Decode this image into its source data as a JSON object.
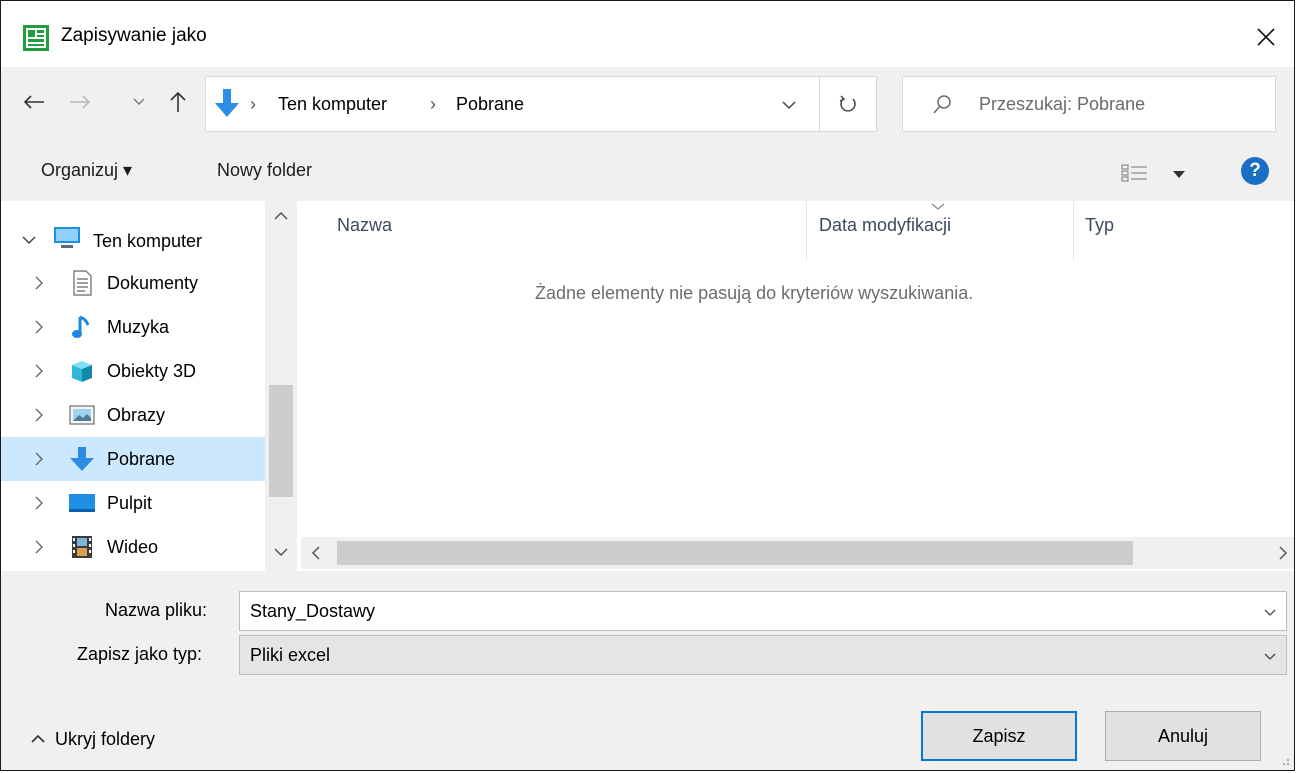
{
  "window": {
    "title": "Zapisywanie jako",
    "close_icon": "close-icon"
  },
  "nav": {
    "back_icon": "arrow-left-icon",
    "forward_icon": "arrow-right-icon",
    "recent_icon": "chevron-down-icon",
    "up_icon": "arrow-up-icon",
    "breadcrumb": [
      "Ten komputer",
      "Pobrane"
    ],
    "separator": "›",
    "search_placeholder": "Przeszukaj: Pobrane"
  },
  "toolbar": {
    "organize": "Organizuj ▾",
    "new_folder": "Nowy folder",
    "help": "?"
  },
  "tree": {
    "items": [
      {
        "label": "Ten komputer",
        "icon": "computer-icon",
        "expanded": true
      },
      {
        "label": "Dokumenty",
        "icon": "document-icon"
      },
      {
        "label": "Muzyka",
        "icon": "music-note-icon"
      },
      {
        "label": "Obiekty 3D",
        "icon": "cube-3d-icon"
      },
      {
        "label": "Obrazy",
        "icon": "pictures-icon"
      },
      {
        "label": "Pobrane",
        "icon": "download-arrow-icon",
        "selected": true
      },
      {
        "label": "Pulpit",
        "icon": "desktop-icon"
      },
      {
        "label": "Wideo",
        "icon": "video-icon"
      }
    ]
  },
  "files": {
    "columns": [
      "Nazwa",
      "Data modyfikacji",
      "Typ"
    ],
    "empty_message": "Żadne elementy nie pasują do kryteriów wyszukiwania."
  },
  "form": {
    "filename_label": "Nazwa pliku:",
    "filename_value": "Stany_Dostawy",
    "filetype_label": "Zapisz jako typ:",
    "filetype_value": "Pliki excel"
  },
  "footer": {
    "hide_folders": "Ukryj foldery",
    "save": "Zapisz",
    "cancel": "Anuluj"
  },
  "colors": {
    "accent": "#0078d7",
    "selected_row": "#cce8ff",
    "panel": "#f0f0f0"
  }
}
